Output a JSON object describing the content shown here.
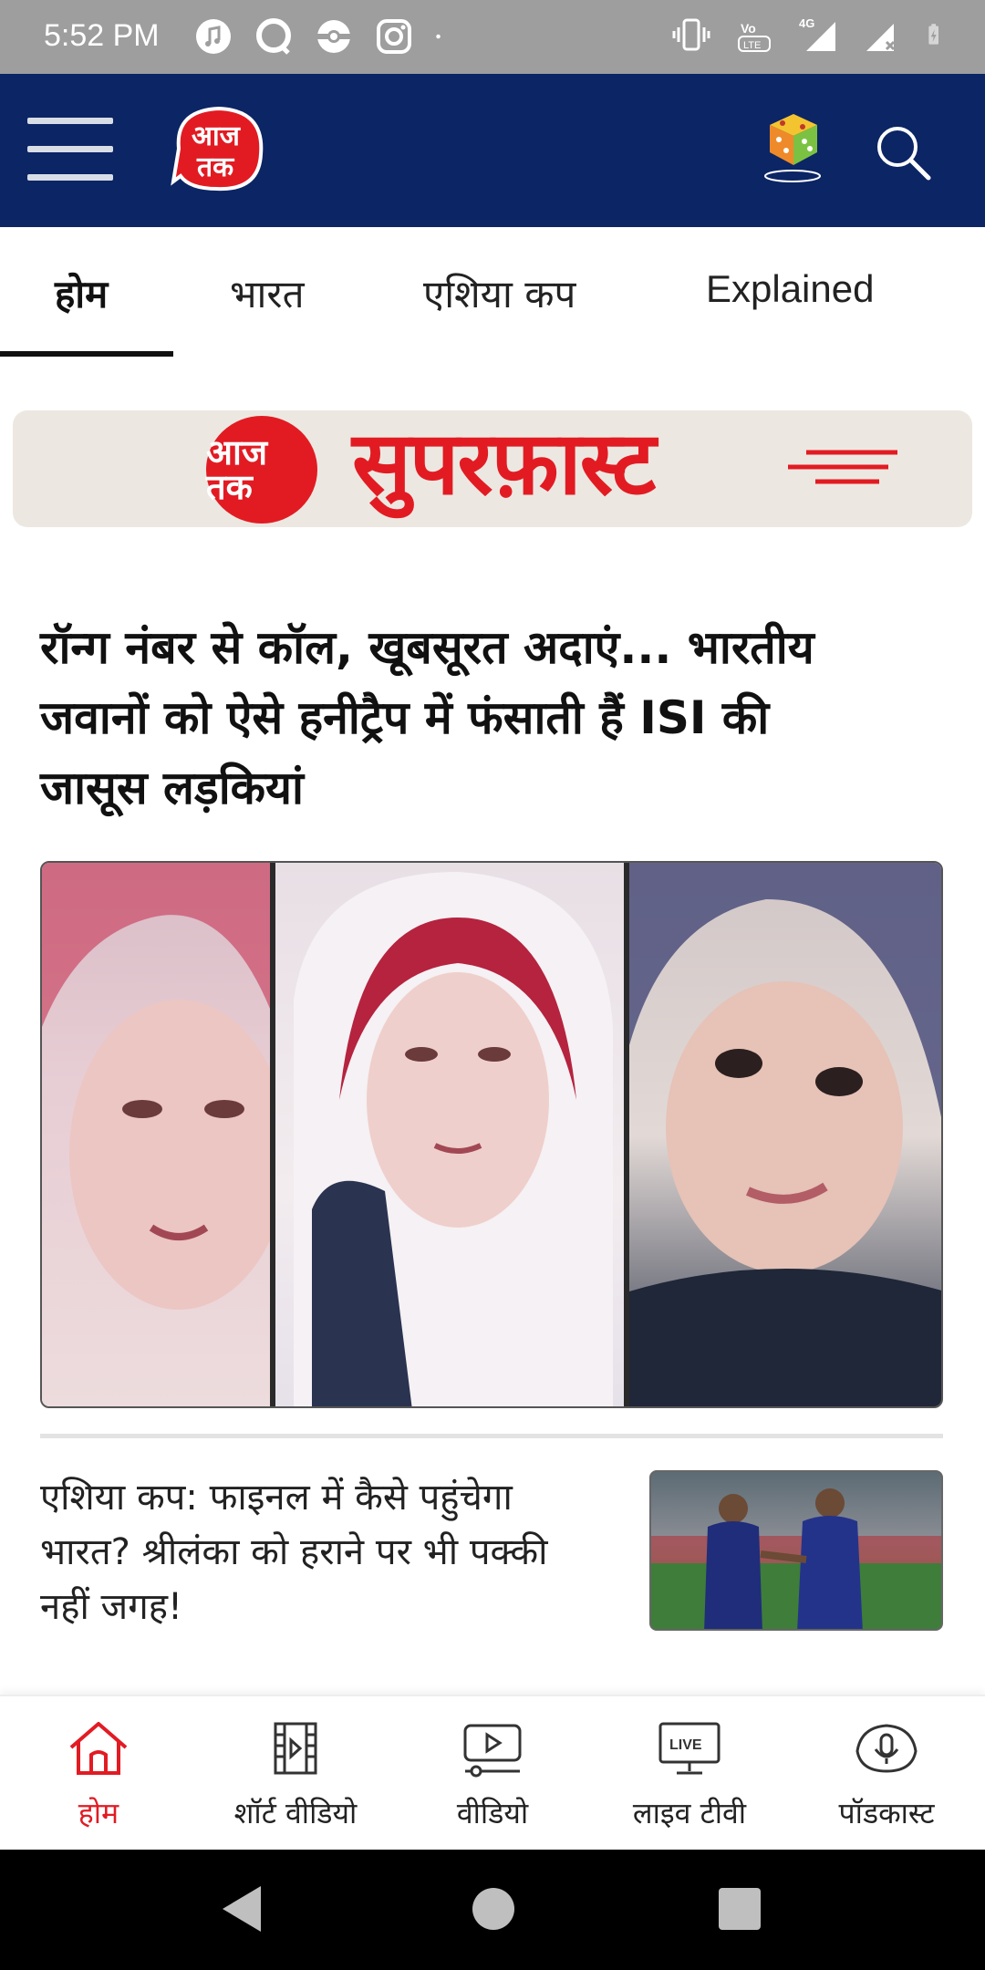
{
  "status_bar": {
    "time": "5:52 PM",
    "network": "4G",
    "volte": "VoLTE"
  },
  "header": {
    "logo_text": "आज तक"
  },
  "tabs": [
    {
      "label": "होम",
      "active": true
    },
    {
      "label": "भारत",
      "active": false
    },
    {
      "label": "एशिया कप",
      "active": false
    },
    {
      "label": "Explained",
      "active": false
    }
  ],
  "banner": {
    "badge": "आज तक",
    "title": "सुपरफ़ास्ट"
  },
  "main_story": {
    "headline": "रॉन्ग नंबर से कॉल, खूबसूरत अदाएं... भारतीय जवानों को ऐसे हनीट्रैप में फंसाती हैं ISI की जासूस लड़कियां"
  },
  "second_story": {
    "headline": "एशिया कप: फाइनल में कैसे पहुंचेगा भारत? श्रीलंका को हराने पर भी पक्की नहीं जगह!"
  },
  "bottom_nav": [
    {
      "label": "होम",
      "icon": "home-icon",
      "active": true
    },
    {
      "label": "शॉर्ट वीडियो",
      "icon": "film-icon",
      "active": false
    },
    {
      "label": "वीडियो",
      "icon": "video-icon",
      "active": false
    },
    {
      "label": "लाइव टीवी",
      "icon": "live-tv-icon",
      "active": false,
      "badge": "LIVE"
    },
    {
      "label": "पॉडकास्ट",
      "icon": "podcast-icon",
      "active": false
    }
  ],
  "colors": {
    "header_bg": "#0b2565",
    "brand_red": "#e21b23",
    "status_bar": "#9e9e9e"
  }
}
